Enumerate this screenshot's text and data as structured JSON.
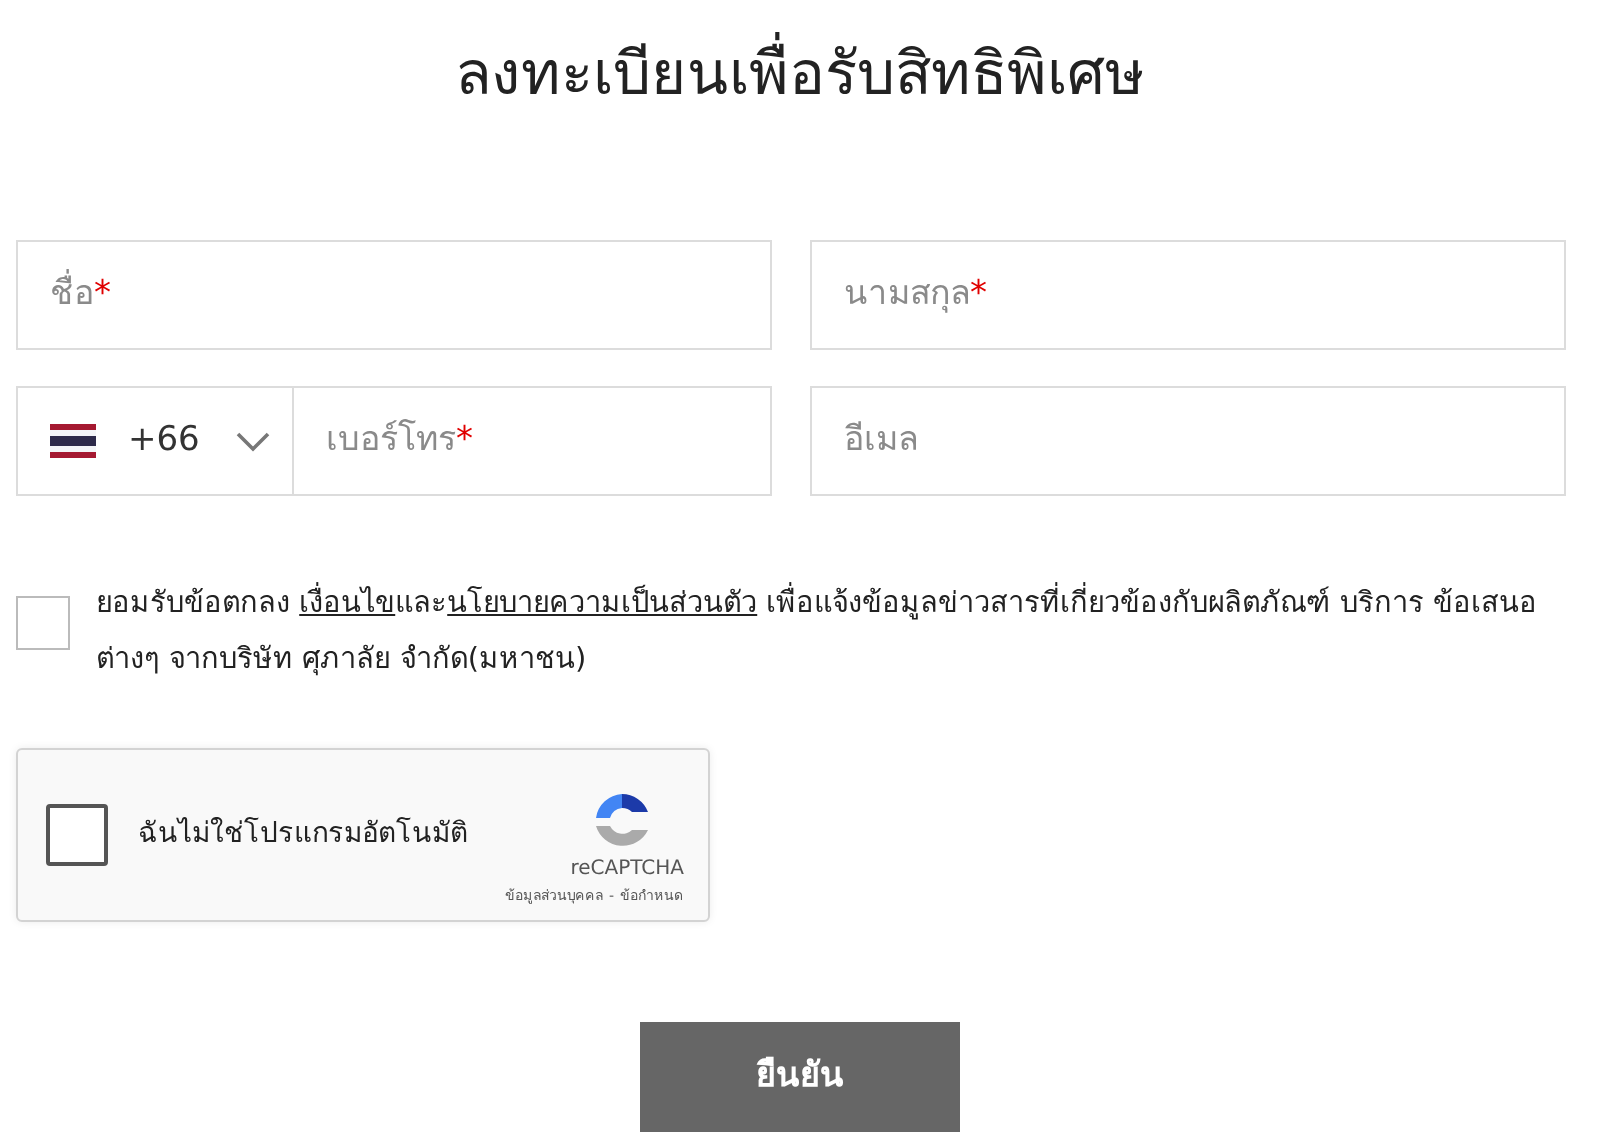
{
  "title": "ลงทะเบียนเพื่อรับสิทธิพิเศษ",
  "fields": [
    {
      "kind": "text",
      "placeholder": "ชื่อ",
      "required_mark": "*"
    },
    {
      "kind": "text",
      "placeholder": "นามสกุล",
      "required_mark": "*"
    },
    {
      "kind": "phone",
      "country_code": "+66",
      "placeholder": "เบอร์โทร",
      "required_mark": "*"
    },
    {
      "kind": "text",
      "placeholder": "อีเมล"
    }
  ],
  "consent": {
    "checked": false,
    "parts": [
      {
        "kind": "text",
        "text": "ยอมรับข้อตกลง "
      },
      {
        "kind": "link",
        "text": "เงื่อนไข"
      },
      {
        "kind": "text",
        "text": "และ"
      },
      {
        "kind": "link",
        "text": "นโยบายความเป็นส่วนตัว"
      },
      {
        "kind": "text",
        "text": " เพื่อแจ้งข้อมูลข่าวสารที่เกี่ยวข้องกับผลิตภัณฑ์ บริการ ข้อเสนอต่างๆ จากบริษัท ศุภาลัย จำกัด(มหาชน)"
      }
    ]
  },
  "captcha": {
    "checked": false,
    "label": "ฉันไม่ใช่โปรแกรมอัตโนมัติ",
    "brand": "reCAPTCHA",
    "privacy_link": "ข้อมูลส่วนบุคคล",
    "separator": "-",
    "terms_link": "ข้อกำหนด"
  },
  "submit_button": "ยืนยัน"
}
